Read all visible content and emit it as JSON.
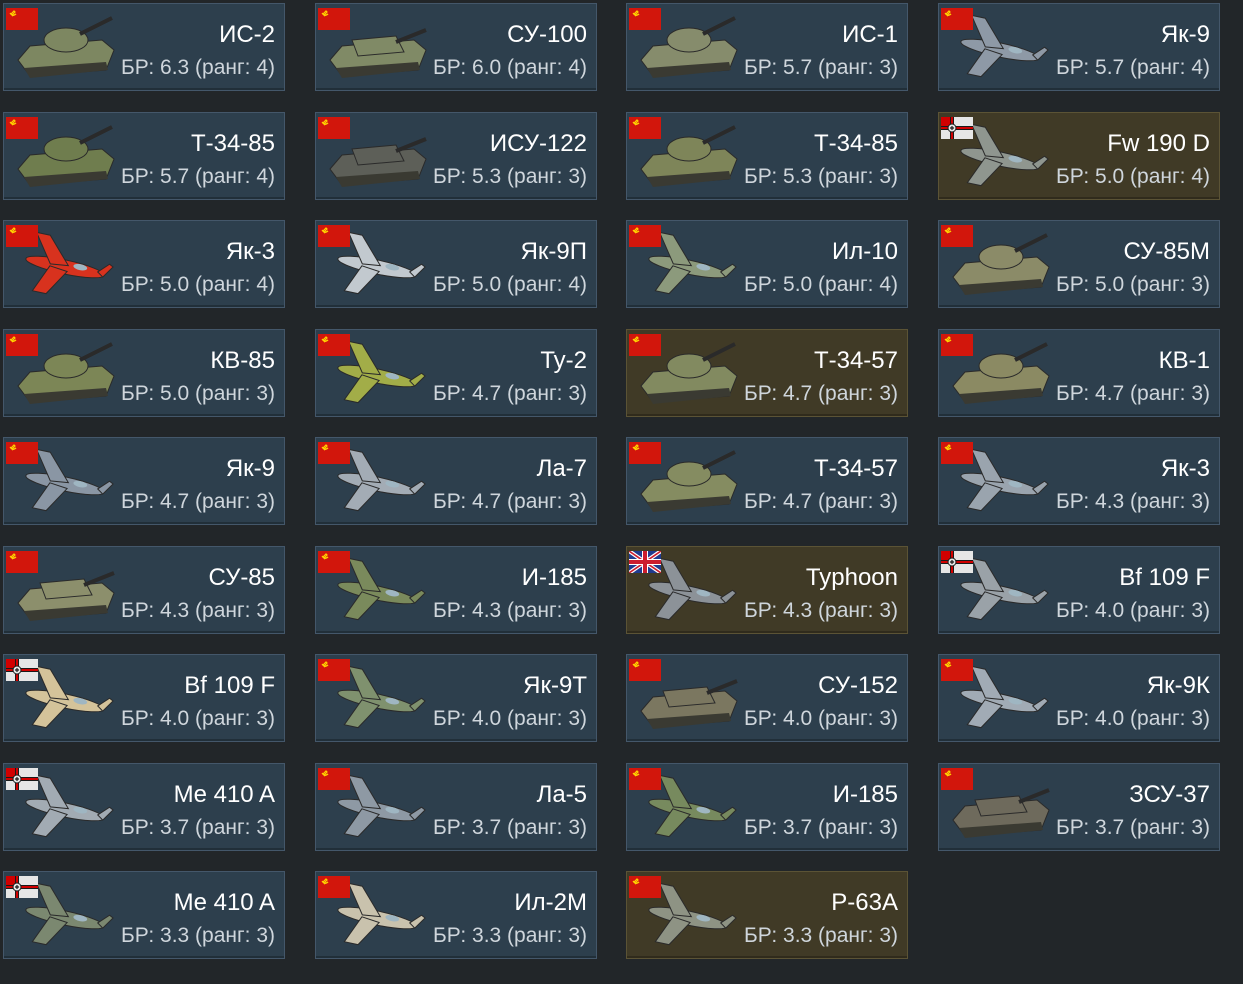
{
  "colors": {
    "background": "#222629",
    "card": "#2d3f4d",
    "card_premium": "#403a26",
    "name_text": "#ffffff",
    "br_text": "#cfd6dc"
  },
  "cards": [
    {
      "name": "ИС-2",
      "br": "БР: 6.3 (ранг: 4)",
      "nation": "ussr",
      "kind": "tank",
      "premium": false,
      "tint": "#7d8761"
    },
    {
      "name": "СУ-100",
      "br": "БР: 6.0 (ранг: 4)",
      "nation": "ussr",
      "kind": "spg",
      "premium": false,
      "tint": "#808a66"
    },
    {
      "name": "ИС-1",
      "br": "БР: 5.7 (ранг: 3)",
      "nation": "ussr",
      "kind": "tank",
      "premium": false,
      "tint": "#868c6c"
    },
    {
      "name": "Як-9",
      "br": "БР: 5.7 (ранг: 4)",
      "nation": "ussr",
      "kind": "plane",
      "premium": false,
      "tint": "#8e99a6"
    },
    {
      "name": "Т-34-85",
      "br": "БР: 5.7 (ранг: 4)",
      "nation": "ussr",
      "kind": "tank",
      "premium": false,
      "tint": "#6f7d4e"
    },
    {
      "name": "ИСУ-122",
      "br": "БР: 5.3 (ранг: 3)",
      "nation": "ussr",
      "kind": "spg",
      "premium": false,
      "tint": "#5d5f58"
    },
    {
      "name": "Т-34-85",
      "br": "БР: 5.3 (ранг: 3)",
      "nation": "ussr",
      "kind": "tank",
      "premium": false,
      "tint": "#7e8559"
    },
    {
      "name": "Fw 190 D",
      "br": "БР: 5.0 (ранг: 4)",
      "nation": "germany",
      "kind": "plane",
      "premium": true,
      "tint": "#8f968f"
    },
    {
      "name": "Як-3",
      "br": "БР: 5.0 (ранг: 4)",
      "nation": "ussr",
      "kind": "plane",
      "premium": false,
      "tint": "#d8321e"
    },
    {
      "name": "Як-9П",
      "br": "БР: 5.0 (ранг: 4)",
      "nation": "ussr",
      "kind": "plane",
      "premium": false,
      "tint": "#c2c9cf"
    },
    {
      "name": "Ил-10",
      "br": "БР: 5.0 (ранг: 4)",
      "nation": "ussr",
      "kind": "plane",
      "premium": false,
      "tint": "#8c9a7c"
    },
    {
      "name": "СУ-85М",
      "br": "БР: 5.0 (ранг: 3)",
      "nation": "ussr",
      "kind": "tank",
      "premium": false,
      "tint": "#8b8b68"
    },
    {
      "name": "КВ-85",
      "br": "БР: 5.0 (ранг: 3)",
      "nation": "ussr",
      "kind": "tank",
      "premium": false,
      "tint": "#7c8656"
    },
    {
      "name": "Ту-2",
      "br": "БР: 4.7 (ранг: 3)",
      "nation": "ussr",
      "kind": "plane",
      "premium": false,
      "tint": "#a2ad48"
    },
    {
      "name": "Т-34-57",
      "br": "БР: 4.7 (ранг: 3)",
      "nation": "ussr",
      "kind": "tank",
      "premium": true,
      "tint": "#828a60"
    },
    {
      "name": "КВ-1",
      "br": "БР: 4.7 (ранг: 3)",
      "nation": "ussr",
      "kind": "tank",
      "premium": false,
      "tint": "#8b8a63"
    },
    {
      "name": "Як-9",
      "br": "БР: 4.7 (ранг: 3)",
      "nation": "ussr",
      "kind": "plane",
      "premium": false,
      "tint": "#8a96a4"
    },
    {
      "name": "Ла-7",
      "br": "БР: 4.7 (ранг: 3)",
      "nation": "ussr",
      "kind": "plane",
      "premium": false,
      "tint": "#a3acb5"
    },
    {
      "name": "Т-34-57",
      "br": "БР: 4.7 (ранг: 3)",
      "nation": "ussr",
      "kind": "tank",
      "premium": false,
      "tint": "#858c61"
    },
    {
      "name": "Як-3",
      "br": "БР: 4.3 (ранг: 3)",
      "nation": "ussr",
      "kind": "plane",
      "premium": false,
      "tint": "#9aa4ae"
    },
    {
      "name": "СУ-85",
      "br": "БР: 4.3 (ранг: 3)",
      "nation": "ussr",
      "kind": "spg",
      "premium": false,
      "tint": "#8c8f6c"
    },
    {
      "name": "И-185",
      "br": "БР: 4.3 (ранг: 3)",
      "nation": "ussr",
      "kind": "plane",
      "premium": false,
      "tint": "#7a8a5c"
    },
    {
      "name": "Typhoon",
      "br": "БР: 4.3 (ранг: 3)",
      "nation": "uk",
      "kind": "plane",
      "premium": true,
      "tint": "#8c9298"
    },
    {
      "name": "Bf 109 F",
      "br": "БР: 4.0 (ранг: 3)",
      "nation": "germany",
      "kind": "plane",
      "premium": false,
      "tint": "#9aa2a8"
    },
    {
      "name": "Bf 109 F",
      "br": "БР: 4.0 (ранг: 3)",
      "nation": "germany",
      "kind": "plane",
      "premium": false,
      "tint": "#d4c39a"
    },
    {
      "name": "Як-9Т",
      "br": "БР: 4.0 (ранг: 3)",
      "nation": "ussr",
      "kind": "plane",
      "premium": false,
      "tint": "#7f916e"
    },
    {
      "name": "СУ-152",
      "br": "БР: 4.0 (ранг: 3)",
      "nation": "ussr",
      "kind": "spg",
      "premium": false,
      "tint": "#7b7760"
    },
    {
      "name": "Як-9К",
      "br": "БР: 4.0 (ранг: 3)",
      "nation": "ussr",
      "kind": "plane",
      "premium": false,
      "tint": "#a1abb5"
    },
    {
      "name": "Me 410 A",
      "br": "БР: 3.7 (ранг: 3)",
      "nation": "germany",
      "kind": "plane",
      "premium": false,
      "tint": "#a2abb3"
    },
    {
      "name": "Ла-5",
      "br": "БР: 3.7 (ранг: 3)",
      "nation": "ussr",
      "kind": "plane",
      "premium": false,
      "tint": "#8e99a4"
    },
    {
      "name": "И-185",
      "br": "БР: 3.7 (ранг: 3)",
      "nation": "ussr",
      "kind": "plane",
      "premium": false,
      "tint": "#778a5e"
    },
    {
      "name": "ЗСУ-37",
      "br": "БР: 3.7 (ранг: 3)",
      "nation": "ussr",
      "kind": "spg",
      "premium": false,
      "tint": "#6e6a5c"
    },
    {
      "name": "Me 410 A",
      "br": "БР: 3.3 (ранг: 3)",
      "nation": "germany",
      "kind": "plane",
      "premium": false,
      "tint": "#7b8870"
    },
    {
      "name": "Ил-2М",
      "br": "БР: 3.3 (ранг: 3)",
      "nation": "ussr",
      "kind": "plane",
      "premium": false,
      "tint": "#c9c2ad"
    },
    {
      "name": "P-63A",
      "br": "БР: 3.3 (ранг: 3)",
      "nation": "ussr",
      "kind": "plane",
      "premium": true,
      "tint": "#8e9384"
    }
  ]
}
